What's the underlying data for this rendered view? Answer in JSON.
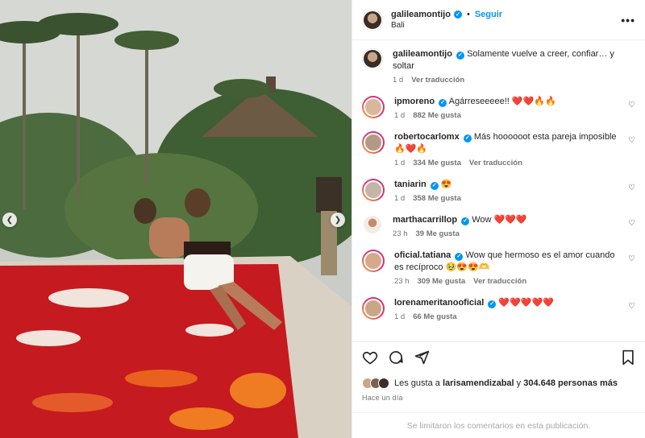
{
  "post": {
    "author": "galileamontijo",
    "follow_label": "Seguir",
    "location": "Bali",
    "more_label": "•••"
  },
  "caption": {
    "author": "galileamontijo",
    "text": "Solamente vuelve a creer, confiar… y soltar",
    "time": "1 d",
    "translate": "Ver traducción"
  },
  "comments": [
    {
      "user": "ipmoreno",
      "text": "Agárreseeeee!!",
      "emoji": "❤️❤️🔥🔥",
      "time": "1 d",
      "likes": "882 Me gusta",
      "translate": ""
    },
    {
      "user": "robertocarlomx",
      "text": "Más hoooooot esta pareja imposible",
      "emoji": "🔥❤️🔥",
      "time": "1 d",
      "likes": "334 Me gusta",
      "translate": "Ver traducción"
    },
    {
      "user": "taniarin",
      "text": "",
      "emoji": "😍",
      "time": "1 d",
      "likes": "358 Me gusta",
      "translate": ""
    },
    {
      "user": "marthacarrillop",
      "text": "Wow",
      "emoji": "❤️❤️❤️",
      "time": "23 h",
      "likes": "39 Me gusta",
      "translate": ""
    },
    {
      "user": "oficial.tatiana",
      "text": "Wow que hermoso es el amor cuando es recíproco",
      "emoji": "🥹😍😍🫶",
      "time": "23 h",
      "likes": "309 Me gusta",
      "translate": "Ver traducción"
    },
    {
      "user": "lorenameritanooficial",
      "text": "",
      "emoji": "❤️❤️❤️❤️❤️",
      "time": "1 d",
      "likes": "66 Me gusta",
      "translate": ""
    }
  ],
  "likes_line": {
    "prefix": "Les gusta a",
    "user": "larisamendizabal",
    "middle": "y",
    "count": "304.648 personas más"
  },
  "posted": "Hace un día",
  "limited_notice": "Se limitaron los comentarios en esta publicación.",
  "icons": [
    "heart-icon",
    "comment-icon",
    "share-icon",
    "bookmark-icon",
    "chevron-left-icon",
    "chevron-right-icon",
    "verified-icon",
    "more-icon"
  ],
  "colors": {
    "accent": "#0095f6",
    "muted": "#737373",
    "text": "#262626"
  }
}
